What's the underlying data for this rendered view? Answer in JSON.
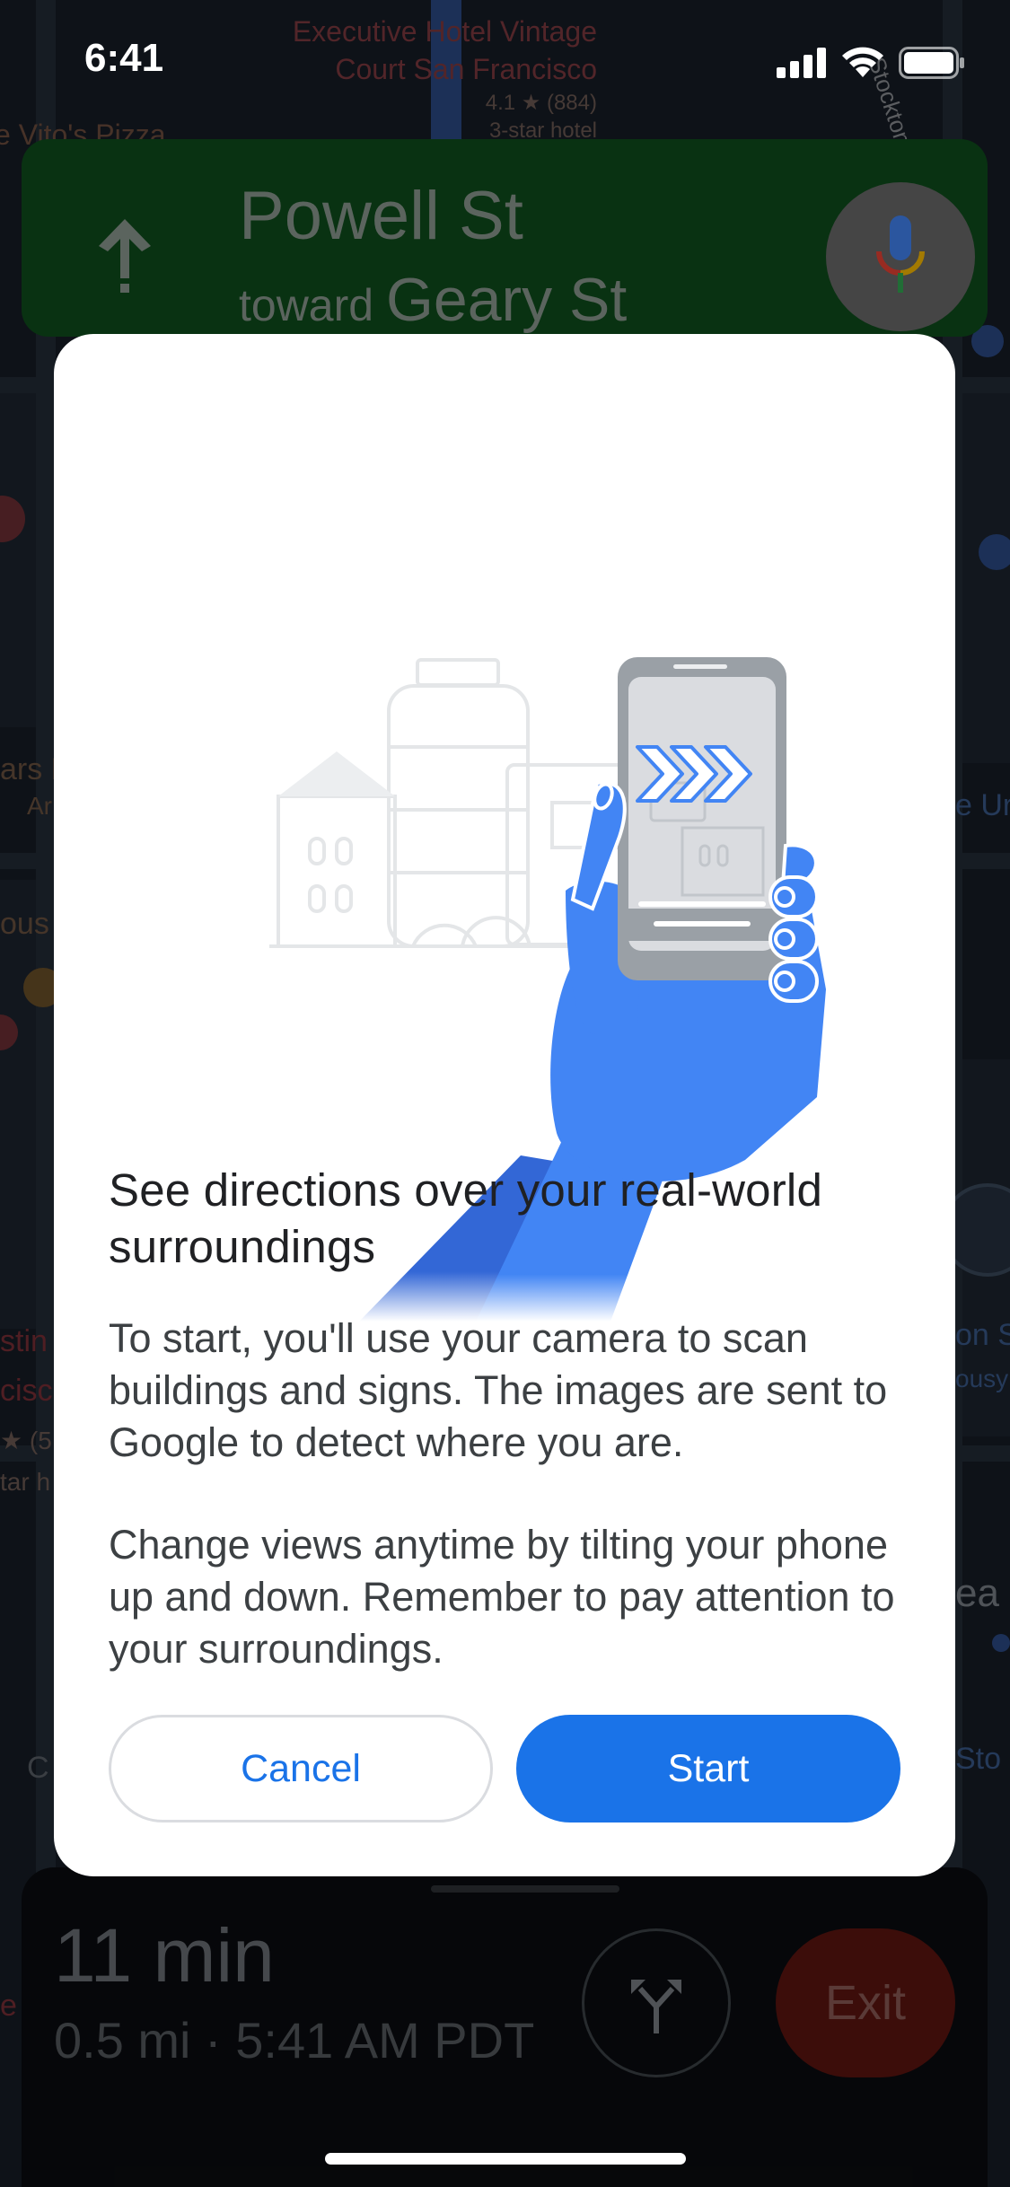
{
  "status_bar": {
    "time": "6:41"
  },
  "map": {
    "hotel_name_line1": "Executive Hotel Vintage",
    "hotel_name_line2": "Court San Francisco",
    "hotel_rating": "4.1 ★ (884)",
    "hotel_class": "3-star hotel",
    "pizza": "e Vito's Pizza",
    "street_right": "Stockton St",
    "left_fragments": [
      "ars F",
      "Ar",
      "ous",
      "stin",
      "cisc",
      "★ (5",
      "tar h",
      "C",
      "e"
    ],
    "right_fragments": [
      "e Ur",
      "on S",
      "ousy",
      "ea",
      "Sto"
    ]
  },
  "nav": {
    "street": "Powell St",
    "toward_prefix": "toward",
    "toward_street": "Geary St"
  },
  "trip": {
    "eta": "11 min",
    "details": "0.5 mi · 5:41 AM PDT",
    "exit_label": "Exit"
  },
  "dialog": {
    "title": "See directions over your real-world surroundings",
    "body1": "To start, you'll use your camera to scan buildings and signs. The images are sent to Google to detect where you are.",
    "body2": "Change views anytime by tilting your phone up and down. Remember to pay attention to your surroundings.",
    "cancel_label": "Cancel",
    "start_label": "Start"
  },
  "colors": {
    "accent": "#1a73e8",
    "nav_green": "#0f4d1c",
    "hand_blue": "#4285f4",
    "exit_red": "#5d1410"
  }
}
